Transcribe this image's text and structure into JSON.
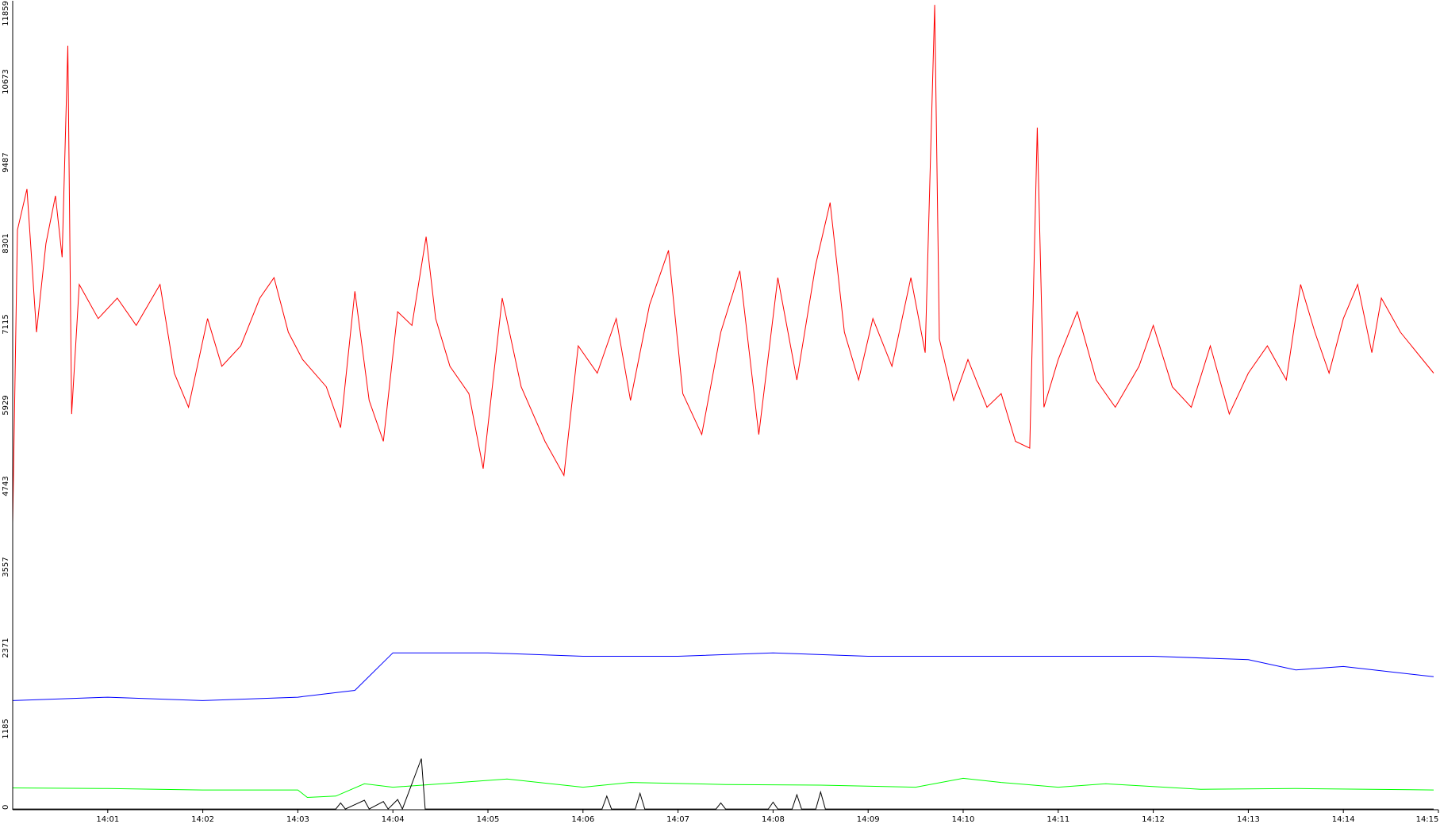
{
  "chart_data": {
    "type": "line",
    "title": "",
    "xlabel": "",
    "ylabel": "",
    "ylim": [
      0,
      11859
    ],
    "y_ticks": [
      "0",
      "1185",
      "2371",
      "3557",
      "4743",
      "5929",
      "7115",
      "8301",
      "9487",
      "10673",
      "11859"
    ],
    "x_ticks": [
      "14:01",
      "14:02",
      "14:03",
      "14:04",
      "14:05",
      "14:06",
      "14:07",
      "14:08",
      "14:09",
      "14:10",
      "14:11",
      "14:12",
      "14:13",
      "14:14",
      "14:15"
    ],
    "x_range_minutes": [
      0,
      15
    ],
    "grid": false,
    "legend": "none",
    "series": [
      {
        "color": "#ff0000",
        "points": [
          [
            0.0,
            4200
          ],
          [
            0.05,
            8500
          ],
          [
            0.15,
            9100
          ],
          [
            0.25,
            7000
          ],
          [
            0.35,
            8300
          ],
          [
            0.45,
            9000
          ],
          [
            0.52,
            8100
          ],
          [
            0.58,
            11200
          ],
          [
            0.62,
            5800
          ],
          [
            0.7,
            7700
          ],
          [
            0.9,
            7200
          ],
          [
            1.1,
            7500
          ],
          [
            1.3,
            7100
          ],
          [
            1.55,
            7700
          ],
          [
            1.7,
            6400
          ],
          [
            1.85,
            5900
          ],
          [
            2.05,
            7200
          ],
          [
            2.2,
            6500
          ],
          [
            2.4,
            6800
          ],
          [
            2.6,
            7500
          ],
          [
            2.75,
            7800
          ],
          [
            2.9,
            7000
          ],
          [
            3.05,
            6600
          ],
          [
            3.3,
            6200
          ],
          [
            3.45,
            5600
          ],
          [
            3.6,
            7600
          ],
          [
            3.75,
            6000
          ],
          [
            3.9,
            5400
          ],
          [
            4.05,
            7300
          ],
          [
            4.2,
            7100
          ],
          [
            4.35,
            8400
          ],
          [
            4.45,
            7200
          ],
          [
            4.6,
            6500
          ],
          [
            4.8,
            6100
          ],
          [
            4.95,
            5000
          ],
          [
            5.15,
            7500
          ],
          [
            5.35,
            6200
          ],
          [
            5.6,
            5400
          ],
          [
            5.8,
            4900
          ],
          [
            5.95,
            6800
          ],
          [
            6.15,
            6400
          ],
          [
            6.35,
            7200
          ],
          [
            6.5,
            6000
          ],
          [
            6.7,
            7400
          ],
          [
            6.9,
            8200
          ],
          [
            7.05,
            6100
          ],
          [
            7.25,
            5500
          ],
          [
            7.45,
            7000
          ],
          [
            7.65,
            7900
          ],
          [
            7.85,
            5500
          ],
          [
            8.05,
            7800
          ],
          [
            8.25,
            6300
          ],
          [
            8.45,
            8000
          ],
          [
            8.6,
            8900
          ],
          [
            8.75,
            7000
          ],
          [
            8.9,
            6300
          ],
          [
            9.05,
            7200
          ],
          [
            9.25,
            6500
          ],
          [
            9.45,
            7800
          ],
          [
            9.6,
            6700
          ],
          [
            9.7,
            11800
          ],
          [
            9.75,
            6900
          ],
          [
            9.9,
            6000
          ],
          [
            10.05,
            6600
          ],
          [
            10.25,
            5900
          ],
          [
            10.4,
            6100
          ],
          [
            10.55,
            5400
          ],
          [
            10.7,
            5300
          ],
          [
            10.78,
            10000
          ],
          [
            10.85,
            5900
          ],
          [
            11.0,
            6600
          ],
          [
            11.2,
            7300
          ],
          [
            11.4,
            6300
          ],
          [
            11.6,
            5900
          ],
          [
            11.85,
            6500
          ],
          [
            12.0,
            7100
          ],
          [
            12.2,
            6200
          ],
          [
            12.4,
            5900
          ],
          [
            12.6,
            6800
          ],
          [
            12.8,
            5800
          ],
          [
            13.0,
            6400
          ],
          [
            13.2,
            6800
          ],
          [
            13.4,
            6300
          ],
          [
            13.55,
            7700
          ],
          [
            13.7,
            7000
          ],
          [
            13.85,
            6400
          ],
          [
            14.0,
            7200
          ],
          [
            14.15,
            7700
          ],
          [
            14.3,
            6700
          ],
          [
            14.4,
            7500
          ],
          [
            14.6,
            7000
          ],
          [
            14.95,
            6400
          ]
        ]
      },
      {
        "color": "#0000ff",
        "points": [
          [
            0.0,
            1600
          ],
          [
            1.0,
            1650
          ],
          [
            2.0,
            1600
          ],
          [
            3.0,
            1650
          ],
          [
            3.6,
            1750
          ],
          [
            4.0,
            2300
          ],
          [
            5.0,
            2300
          ],
          [
            6.0,
            2250
          ],
          [
            7.0,
            2250
          ],
          [
            8.0,
            2300
          ],
          [
            9.0,
            2250
          ],
          [
            10.0,
            2250
          ],
          [
            11.0,
            2250
          ],
          [
            12.0,
            2250
          ],
          [
            13.0,
            2200
          ],
          [
            13.5,
            2050
          ],
          [
            14.0,
            2100
          ],
          [
            14.95,
            1950
          ]
        ]
      },
      {
        "color": "#00ff00",
        "points": [
          [
            0.0,
            320
          ],
          [
            1.0,
            310
          ],
          [
            2.0,
            290
          ],
          [
            3.0,
            290
          ],
          [
            3.1,
            180
          ],
          [
            3.4,
            200
          ],
          [
            3.7,
            380
          ],
          [
            4.0,
            330
          ],
          [
            4.6,
            390
          ],
          [
            5.2,
            450
          ],
          [
            6.0,
            330
          ],
          [
            6.5,
            400
          ],
          [
            7.5,
            370
          ],
          [
            8.5,
            360
          ],
          [
            9.5,
            330
          ],
          [
            10.0,
            460
          ],
          [
            10.4,
            400
          ],
          [
            11.0,
            330
          ],
          [
            11.5,
            380
          ],
          [
            12.5,
            300
          ],
          [
            13.5,
            310
          ],
          [
            14.95,
            290
          ]
        ]
      },
      {
        "color": "#000000",
        "points": [
          [
            0.0,
            10
          ],
          [
            3.4,
            10
          ],
          [
            3.45,
            100
          ],
          [
            3.5,
            10
          ],
          [
            3.7,
            140
          ],
          [
            3.75,
            10
          ],
          [
            3.9,
            120
          ],
          [
            3.95,
            10
          ],
          [
            4.05,
            150
          ],
          [
            4.1,
            10
          ],
          [
            4.3,
            750
          ],
          [
            4.34,
            10
          ],
          [
            6.2,
            10
          ],
          [
            6.25,
            200
          ],
          [
            6.3,
            10
          ],
          [
            6.55,
            10
          ],
          [
            6.6,
            240
          ],
          [
            6.65,
            10
          ],
          [
            7.4,
            10
          ],
          [
            7.45,
            100
          ],
          [
            7.5,
            10
          ],
          [
            7.95,
            10
          ],
          [
            8.0,
            110
          ],
          [
            8.05,
            10
          ],
          [
            8.2,
            10
          ],
          [
            8.25,
            220
          ],
          [
            8.3,
            10
          ],
          [
            8.45,
            10
          ],
          [
            8.5,
            260
          ],
          [
            8.55,
            10
          ],
          [
            14.95,
            10
          ]
        ]
      }
    ]
  }
}
